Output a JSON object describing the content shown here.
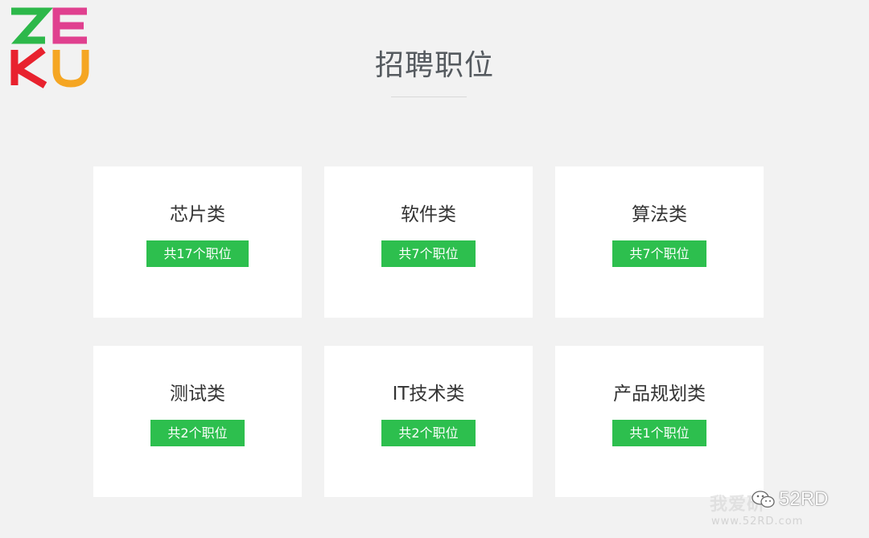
{
  "logo": {
    "text": "ZEKU"
  },
  "header": {
    "title": "招聘职位"
  },
  "categories": [
    {
      "title": "芯片类",
      "count_label": "共17个职位"
    },
    {
      "title": "软件类",
      "count_label": "共7个职位"
    },
    {
      "title": "算法类",
      "count_label": "共7个职位"
    },
    {
      "title": "测试类",
      "count_label": "共2个职位"
    },
    {
      "title": "IT技术类",
      "count_label": "共2个职位"
    },
    {
      "title": "产品规划类",
      "count_label": "共1个职位"
    }
  ],
  "watermark": {
    "faint_text": "我爱研",
    "brand": "52RD",
    "url": "www.52RD.com"
  },
  "colors": {
    "background": "#f2f2f2",
    "card": "#ffffff",
    "badge": "#2dbf4e",
    "title_text": "#555a5f",
    "logo_green": "#2db84a",
    "logo_pink": "#e0408f",
    "logo_red": "#e8222e",
    "logo_orange": "#f5a623"
  }
}
